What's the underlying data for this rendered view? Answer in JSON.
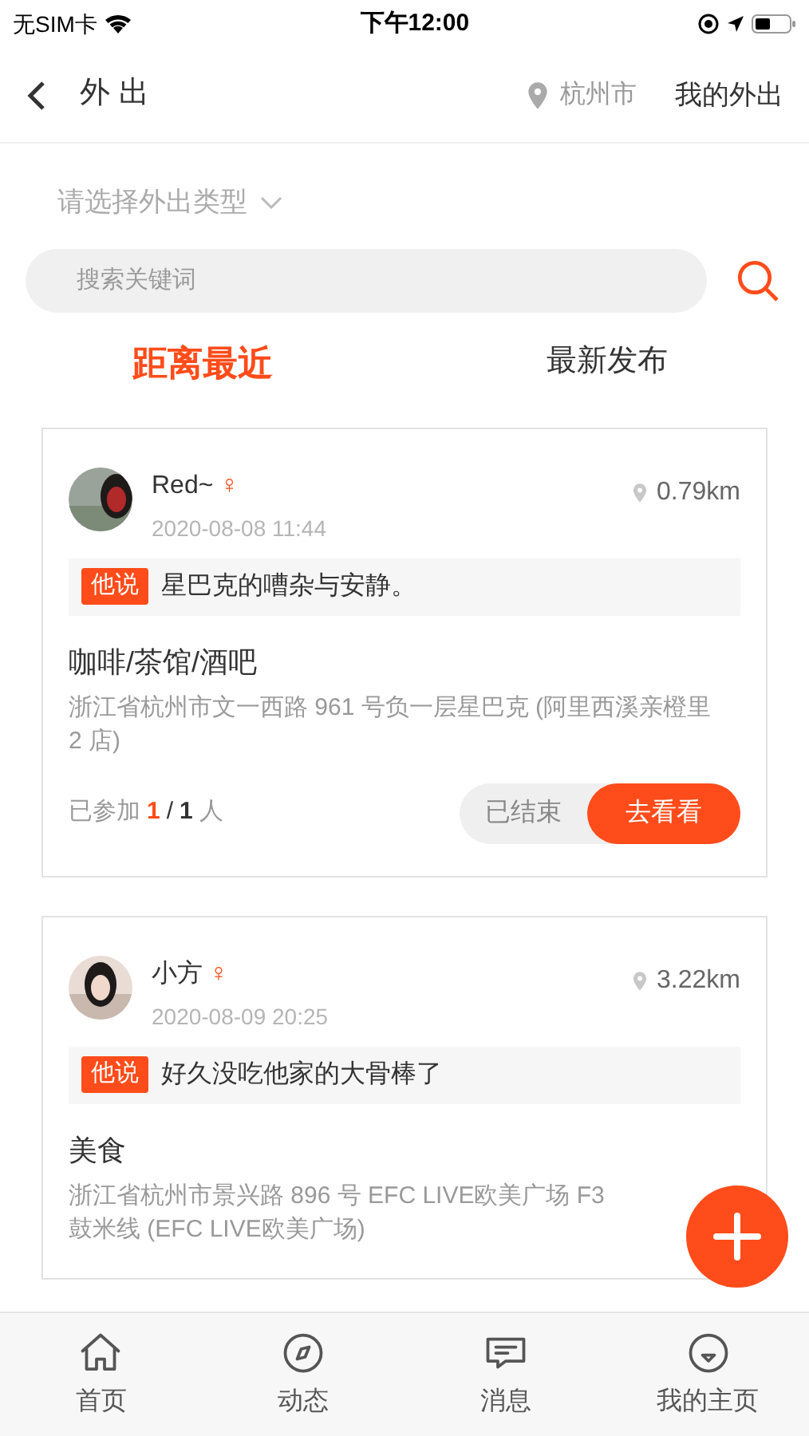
{
  "status_bar": {
    "carrier": "无SIM卡",
    "time": "下午12:00"
  },
  "nav": {
    "title": "外 出",
    "city": "杭州市",
    "action": "我的外出"
  },
  "type_selector": {
    "placeholder": "请选择外出类型"
  },
  "search": {
    "placeholder": "搜索关键词"
  },
  "sort_tabs": [
    {
      "label": "距离最近",
      "selected": true
    },
    {
      "label": "最新发布",
      "selected": false
    }
  ],
  "posts": [
    {
      "name": "Red~",
      "gender": "♀",
      "time": "2020-08-08 11:44",
      "distance": "0.79km",
      "tag": "他说",
      "quote": "星巴克的嘈杂与安静。",
      "category": "咖啡/茶馆/酒吧",
      "address": "浙江省杭州市文一西路 961 号负一层星巴克 (阿里西溪亲橙里 2 店)",
      "joined_label": "已参加",
      "joined": "1",
      "sep": "/",
      "capacity": "1",
      "unit": "人",
      "status": "已结束",
      "button": "去看看"
    },
    {
      "name": "小方",
      "gender": "♀",
      "time": "2020-08-09 20:25",
      "distance": "3.22km",
      "tag": "他说",
      "quote": "好久没吃他家的大骨棒了",
      "category": "美食",
      "address": "浙江省杭州市景兴路 896 号 EFC LIVE欧美广场 F3",
      "address_2": "鼓米线 (EFC LIVE欧美广场)"
    }
  ],
  "tab_bar": [
    {
      "label": "首页",
      "kind": "home",
      "selected": false
    },
    {
      "label": "动态",
      "kind": "compass",
      "selected": false
    },
    {
      "label": "消息",
      "kind": "message",
      "selected": false
    },
    {
      "label": "我的主页",
      "kind": "face",
      "selected": false
    }
  ]
}
